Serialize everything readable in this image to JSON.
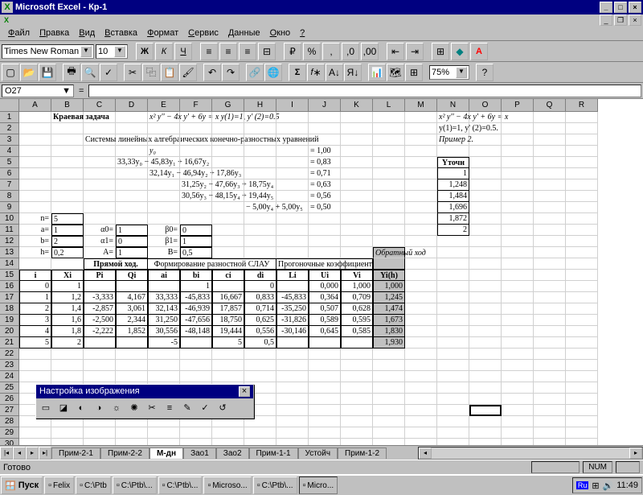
{
  "title": "Microsoft Excel - Кр-1",
  "menu": [
    "Файл",
    "Правка",
    "Вид",
    "Вставка",
    "Формат",
    "Сервис",
    "Данные",
    "Окно",
    "?"
  ],
  "font": {
    "name": "Times New Roman",
    "size": "10"
  },
  "cellref": "O27",
  "zoom": "75%",
  "heading": "Краевая задача",
  "eq1": "x² y'' − 4x y' + 6y = x    y(1)=1,  y' (2)=0.5",
  "eq2": "Системы линейных алгебраических конечно-разностных уравнений",
  "eq_r": "x² y'' − 4x y' + 6y = x",
  "eq_r2": "y(1)=1, y' (2)=0.5.",
  "eq_r3": "Пример 2.",
  "y0": "y₀",
  "sys": [
    "33,33y₀ − 45,83y₁ + 16,67y₂",
    "32,14y₁ − 46,94y₂ + 17,86y₃",
    "31,25y₂ − 47,66y₃ + 18,75y₄",
    "30,56y₃ − 48,15y₄ + 19,44y₅",
    "− 5,00y₄ + 5,00y₅"
  ],
  "rhs": [
    "= 1,00",
    "= 0,83",
    "= 0,71",
    "= 0,63",
    "= 0,56",
    "= 0,50"
  ],
  "params": [
    [
      "n=",
      "5"
    ],
    [
      "a=",
      "1"
    ],
    [
      "b=",
      "2"
    ],
    [
      "h=",
      "0,2"
    ]
  ],
  "greeks": [
    [
      "α0=",
      "1",
      "β0=",
      "0"
    ],
    [
      "α1=",
      "0",
      "β1=",
      "1"
    ],
    [
      "A=",
      "1",
      "B=",
      "0,5"
    ]
  ],
  "headers1": [
    "Прямой ход.",
    "Формирование разностной   СЛАУ",
    "Прогоночные коэффициенты",
    "Обратный ход"
  ],
  "headers2": [
    "i",
    "Xi",
    "Pi",
    "Qi",
    "ai",
    "bi",
    "ci",
    "di",
    "Li",
    "Ui",
    "Vi",
    "Yi(h)"
  ],
  "tdata": [
    [
      "0",
      "1",
      "",
      "",
      "",
      "1",
      "",
      "0",
      "",
      "0,000",
      "1,000",
      "1,000"
    ],
    [
      "1",
      "1,2",
      "-3,333",
      "4,167",
      "33,333",
      "-45,833",
      "16,667",
      "0,833",
      "-45,833",
      "0,364",
      "0,709",
      "1,245"
    ],
    [
      "2",
      "1,4",
      "-2,857",
      "3,061",
      "32,143",
      "-46,939",
      "17,857",
      "0,714",
      "-35,250",
      "0,507",
      "0,628",
      "1,474"
    ],
    [
      "3",
      "1,6",
      "-2,500",
      "2,344",
      "31,250",
      "-47,656",
      "18,750",
      "0,625",
      "-31,826",
      "0,589",
      "0,595",
      "1,673"
    ],
    [
      "4",
      "1,8",
      "-2,222",
      "1,852",
      "30,556",
      "-48,148",
      "19,444",
      "0,556",
      "-30,146",
      "0,645",
      "0,585",
      "1,830"
    ],
    [
      "5",
      "2",
      "",
      "",
      "-5",
      "",
      "5",
      "0,5",
      "",
      "",
      "",
      "1,930"
    ]
  ],
  "ytochn": [
    "Yточн",
    "1",
    "1,248",
    "1,484",
    "1,696",
    "1,872",
    "2"
  ],
  "tabs": [
    "Прим-2-1",
    "Прим-2-2",
    "М-дн",
    "Зао1",
    "Зао2",
    "Прим-1-1",
    "Устойч",
    "Прим-1-2"
  ],
  "active_tab": "М-дн",
  "status": "Готово",
  "float": "Настройка изображения",
  "taskbtns": [
    "Felix",
    "C:\\Ptb",
    "C:\\Ptb\\...",
    "C:\\Ptb\\...",
    "Microso...",
    "C:\\Ptb\\...",
    "Micro..."
  ],
  "time": "11:49",
  "num": "NUM"
}
